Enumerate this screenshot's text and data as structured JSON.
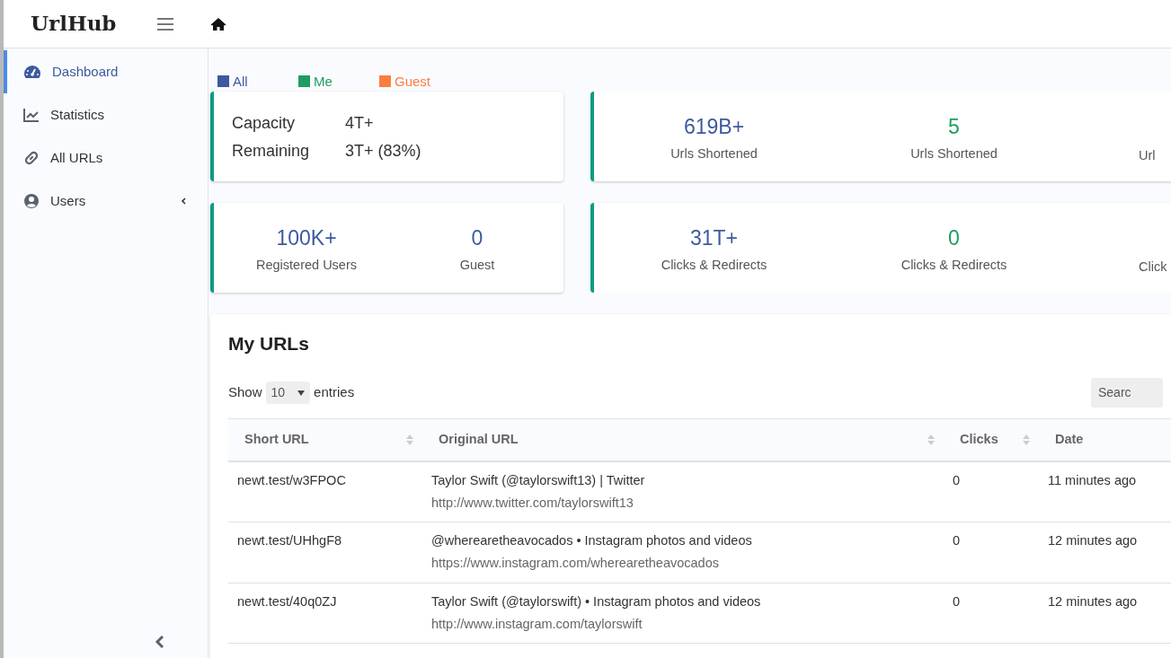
{
  "brand": "UrlHub",
  "sidebar": {
    "items": [
      {
        "label": "Dashboard",
        "selected": true
      },
      {
        "label": "Statistics",
        "selected": false
      },
      {
        "label": "All URLs",
        "selected": false
      },
      {
        "label": "Users",
        "selected": false,
        "expanded": false
      }
    ]
  },
  "legend": [
    {
      "label": "All",
      "color": "#3d5a9e"
    },
    {
      "label": "Me",
      "color": "#1f9d60"
    },
    {
      "label": "Guest",
      "color": "#fd7e3f"
    }
  ],
  "capacity": [
    {
      "label": "Capacity",
      "value": "4T+"
    },
    {
      "label": "Remaining",
      "value": "3T+ (83%)"
    }
  ],
  "url_stats": [
    {
      "value": "619B+",
      "label": "Urls Shortened"
    },
    {
      "value": "5",
      "label": "Urls Shortened"
    },
    {
      "label": "Url"
    }
  ],
  "user_stats": [
    {
      "value": "100K+",
      "label": "Registered Users"
    },
    {
      "value": "0",
      "label": "Guest"
    }
  ],
  "click_stats": [
    {
      "value": "31T+",
      "label": "Clicks & Redirects"
    },
    {
      "value": "0",
      "label": "Clicks & Redirects"
    },
    {
      "label": "Click"
    }
  ],
  "table": {
    "title": "My URLs",
    "show_label": "Show",
    "page_size": "10",
    "entries_label": "entries",
    "search": {
      "placeholder": "Searc"
    },
    "columns": [
      "Short URL",
      "Original URL",
      "Clicks",
      "Date"
    ],
    "rows": [
      {
        "short": "newt.test/w3FPOC",
        "title": "Taylor Swift (@taylorswift13) | Twitter",
        "url": "http://www.twitter.com/taylorswift13",
        "clicks": "0",
        "date": "11 minutes ago"
      },
      {
        "short": "newt.test/UHhgF8",
        "title": "@wherearetheavocados • Instagram photos and videos",
        "url": "https://www.instagram.com/wherearetheavocados",
        "clicks": "0",
        "date": "12 minutes ago"
      },
      {
        "short": "newt.test/40q0ZJ",
        "title": "Taylor Swift (@taylorswift) • Instagram photos and videos",
        "url": "http://www.instagram.com/taylorswift",
        "clicks": "0",
        "date": "12 minutes ago"
      }
    ]
  }
}
